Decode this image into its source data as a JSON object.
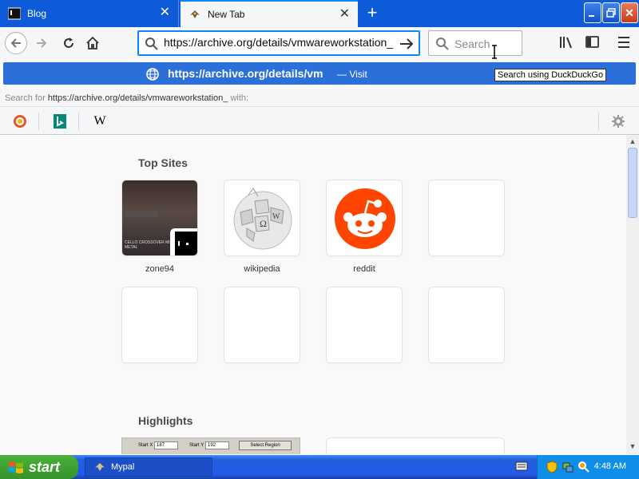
{
  "tabs": [
    {
      "title": "Blog",
      "favicon": "terminal-icon",
      "active": false
    },
    {
      "title": "New Tab",
      "favicon": "mypal-icon",
      "active": true
    }
  ],
  "window_controls": {
    "minimize": "minimize-icon",
    "maximize": "restore-icon",
    "close": "close-icon"
  },
  "navbar": {
    "url_value": "https://archive.org/details/vmwareworkstation_",
    "search_placeholder": "Search"
  },
  "autocomplete": {
    "visit_url": "https://archive.org/details/vm",
    "visit_action": "— Visit",
    "search_for_prefix": "Search for ",
    "search_for_query": "https://archive.org/details/vmwareworkstation_",
    "search_for_suffix": " with:",
    "engines": [
      "DuckDuckGo",
      "Bing",
      "Wikipedia"
    ]
  },
  "tooltip": "Search using DuckDuckGo",
  "newtab": {
    "top_sites_title": "Top Sites",
    "top_sites": [
      {
        "label": "zone94",
        "thumb_text": "CELLO CROSSOVER MI... METAL"
      },
      {
        "label": "wikipedia"
      },
      {
        "label": "reddit"
      },
      {
        "label": ""
      }
    ],
    "highlights_title": "Highlights",
    "highlight_thumb_labels": [
      "Start X",
      "187",
      "Start Y",
      "192",
      "Select Region"
    ]
  },
  "taskbar": {
    "start_label": "start",
    "task_label": "Mypal",
    "clock": "4:48 AM"
  },
  "colors": {
    "tabbar_blue": "#0d5bd8",
    "accent": "#0a84ff",
    "reddit_orange": "#ff4500",
    "xp_taskbar": "#245edb",
    "xp_start_green": "#37932b"
  }
}
